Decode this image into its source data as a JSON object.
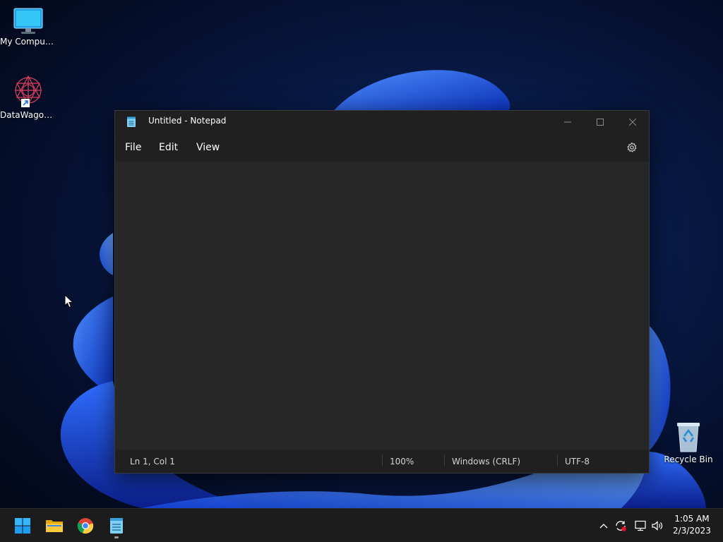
{
  "desktop": {
    "icons": [
      {
        "label": "My Computer",
        "icon": "monitor-icon"
      },
      {
        "label": "DataWagon...",
        "icon": "datawagon-shortcut-icon"
      },
      {
        "label": "Recycle Bin",
        "icon": "recycle-bin-icon"
      }
    ]
  },
  "notepad": {
    "title": "Untitled - Notepad",
    "app_icon": "notepad-icon",
    "menu": [
      "File",
      "Edit",
      "View"
    ],
    "settings_icon": "gear-icon",
    "content": "",
    "status": {
      "position": "Ln 1, Col 1",
      "zoom": "100%",
      "line_endings": "Windows (CRLF)",
      "encoding": "UTF-8"
    }
  },
  "taskbar": {
    "pinned": [
      {
        "name": "Start",
        "icon": "windows-start-icon"
      },
      {
        "name": "File Explorer",
        "icon": "folder-icon"
      },
      {
        "name": "Google Chrome",
        "icon": "chrome-icon"
      },
      {
        "name": "Notepad",
        "icon": "notepad-icon"
      }
    ],
    "tray_icons": [
      "chevron-up-icon",
      "sync-alert-icon",
      "network-icon",
      "volume-icon"
    ],
    "clock": {
      "time": "1:05 AM",
      "date": "2/3/2023"
    }
  },
  "colors": {
    "window_bg": "#202020",
    "editor_bg": "#272727",
    "taskbar_bg": "#1c1c1c",
    "accent_blue": "#1a6cf0"
  }
}
